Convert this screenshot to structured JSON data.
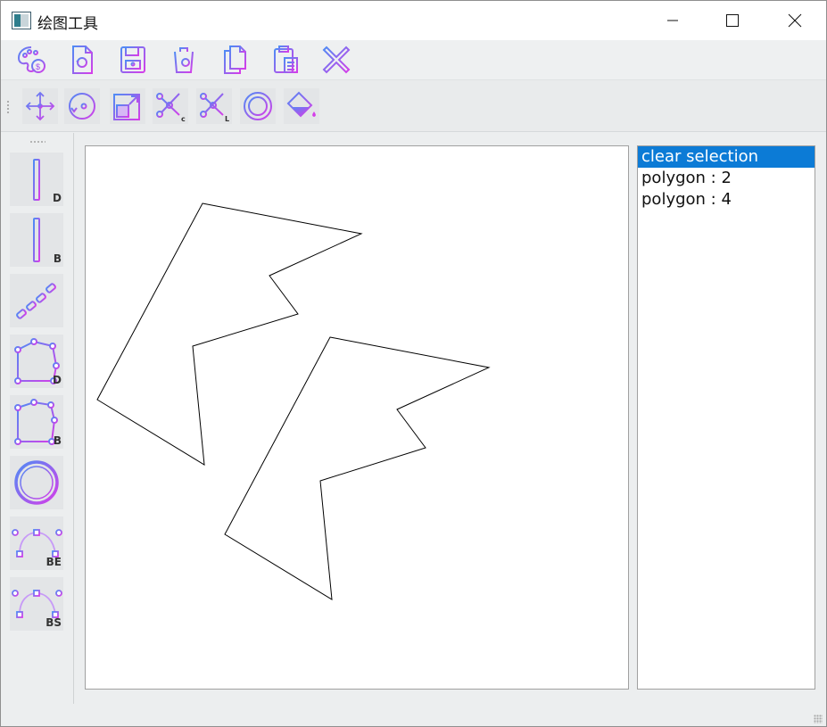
{
  "window": {
    "title": "绘图工具"
  },
  "toolbar_top": {
    "icons": [
      "palette-icon",
      "new-file-icon",
      "save-icon",
      "delete-icon",
      "copy-icon",
      "paste-icon",
      "close-x-icon"
    ]
  },
  "toolbar_tools": {
    "icons": [
      "move-icon",
      "rotate-icon",
      "scale-icon",
      "cut-c-icon",
      "cut-l-icon",
      "circle-target-icon",
      "fill-bucket-icon"
    ],
    "cut_c_sub": "c",
    "cut_l_sub": "L"
  },
  "left_tools": [
    {
      "name": "line-d",
      "sub": "D"
    },
    {
      "name": "line-b",
      "sub": "B"
    },
    {
      "name": "chain",
      "sub": ""
    },
    {
      "name": "polygon-d",
      "sub": "D"
    },
    {
      "name": "polygon-b",
      "sub": "B"
    },
    {
      "name": "circle",
      "sub": ""
    },
    {
      "name": "curve-be",
      "sub": "BE"
    },
    {
      "name": "curve-bs",
      "sub": "BS"
    }
  ],
  "shape_list": {
    "items": [
      "clear selection",
      "polygon : 2",
      "polygon : 4"
    ],
    "selected_index": 0
  },
  "colors": {
    "accent": "#0c7bd6",
    "icon_purple": "#a44cf0",
    "icon_blue": "#5b7cf0"
  }
}
